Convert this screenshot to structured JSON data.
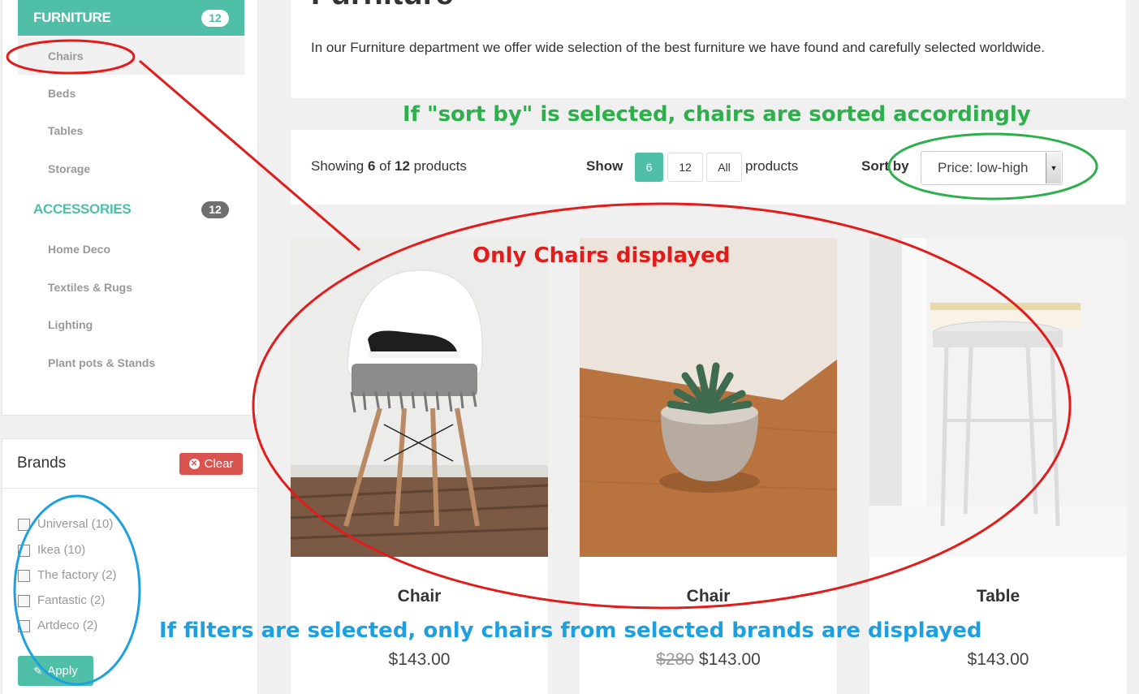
{
  "categories": {
    "furniture": {
      "label": "FURNITURE",
      "count": "12",
      "items": [
        {
          "label": "Chairs",
          "active": true
        },
        {
          "label": "Beds"
        },
        {
          "label": "Tables"
        },
        {
          "label": "Storage"
        }
      ]
    },
    "accessories": {
      "label": "ACCESSORIES",
      "count": "12",
      "items": [
        {
          "label": "Home Deco"
        },
        {
          "label": "Textiles & Rugs"
        },
        {
          "label": "Lighting"
        },
        {
          "label": "Plant pots & Stands"
        }
      ]
    }
  },
  "brands": {
    "title": "Brands",
    "clear_label": "Clear",
    "apply_label": "Apply",
    "items": [
      {
        "label": "Universal (10)"
      },
      {
        "label": "Ikea (10)"
      },
      {
        "label": "The factory (2)"
      },
      {
        "label": "Fantastic (2)"
      },
      {
        "label": "Artdeco (2)"
      }
    ]
  },
  "intro": {
    "title": "Furniture",
    "text": "In our Furniture department we offer wide selection of the best furniture we have found and carefully selected worldwide."
  },
  "toolbar": {
    "showing_prefix": "Showing ",
    "showing_count": "6",
    "showing_of": " of ",
    "showing_total": "12",
    "showing_suffix": " products",
    "show_label": "Show",
    "page_sizes": [
      "6",
      "12",
      "All"
    ],
    "active_page_size": "6",
    "products_label": "products",
    "sort_label": "Sort by",
    "sort_value": "Price: low-high"
  },
  "products": [
    {
      "name": "Chair",
      "old_price": "",
      "price": "$143.00",
      "image": "chair-with-sneakers"
    },
    {
      "name": "Chair",
      "old_price": "$280",
      "price": "$143.00",
      "image": "succulent-pot"
    },
    {
      "name": "Table",
      "old_price": "",
      "price": "$143.00",
      "image": "white-stool"
    }
  ],
  "annotations": {
    "sort_note": "If \"sort by\" is selected, chairs are sorted accordingly",
    "chairs_note": "Only Chairs displayed",
    "filters_note": "If filters are selected, only chairs from selected brands are displayed"
  },
  "colors": {
    "accent": "#4fbfa8",
    "danger": "#d9534f",
    "annotation_red": "#e21b1b",
    "annotation_green": "#2db04b",
    "annotation_blue": "#1ea0e0"
  }
}
